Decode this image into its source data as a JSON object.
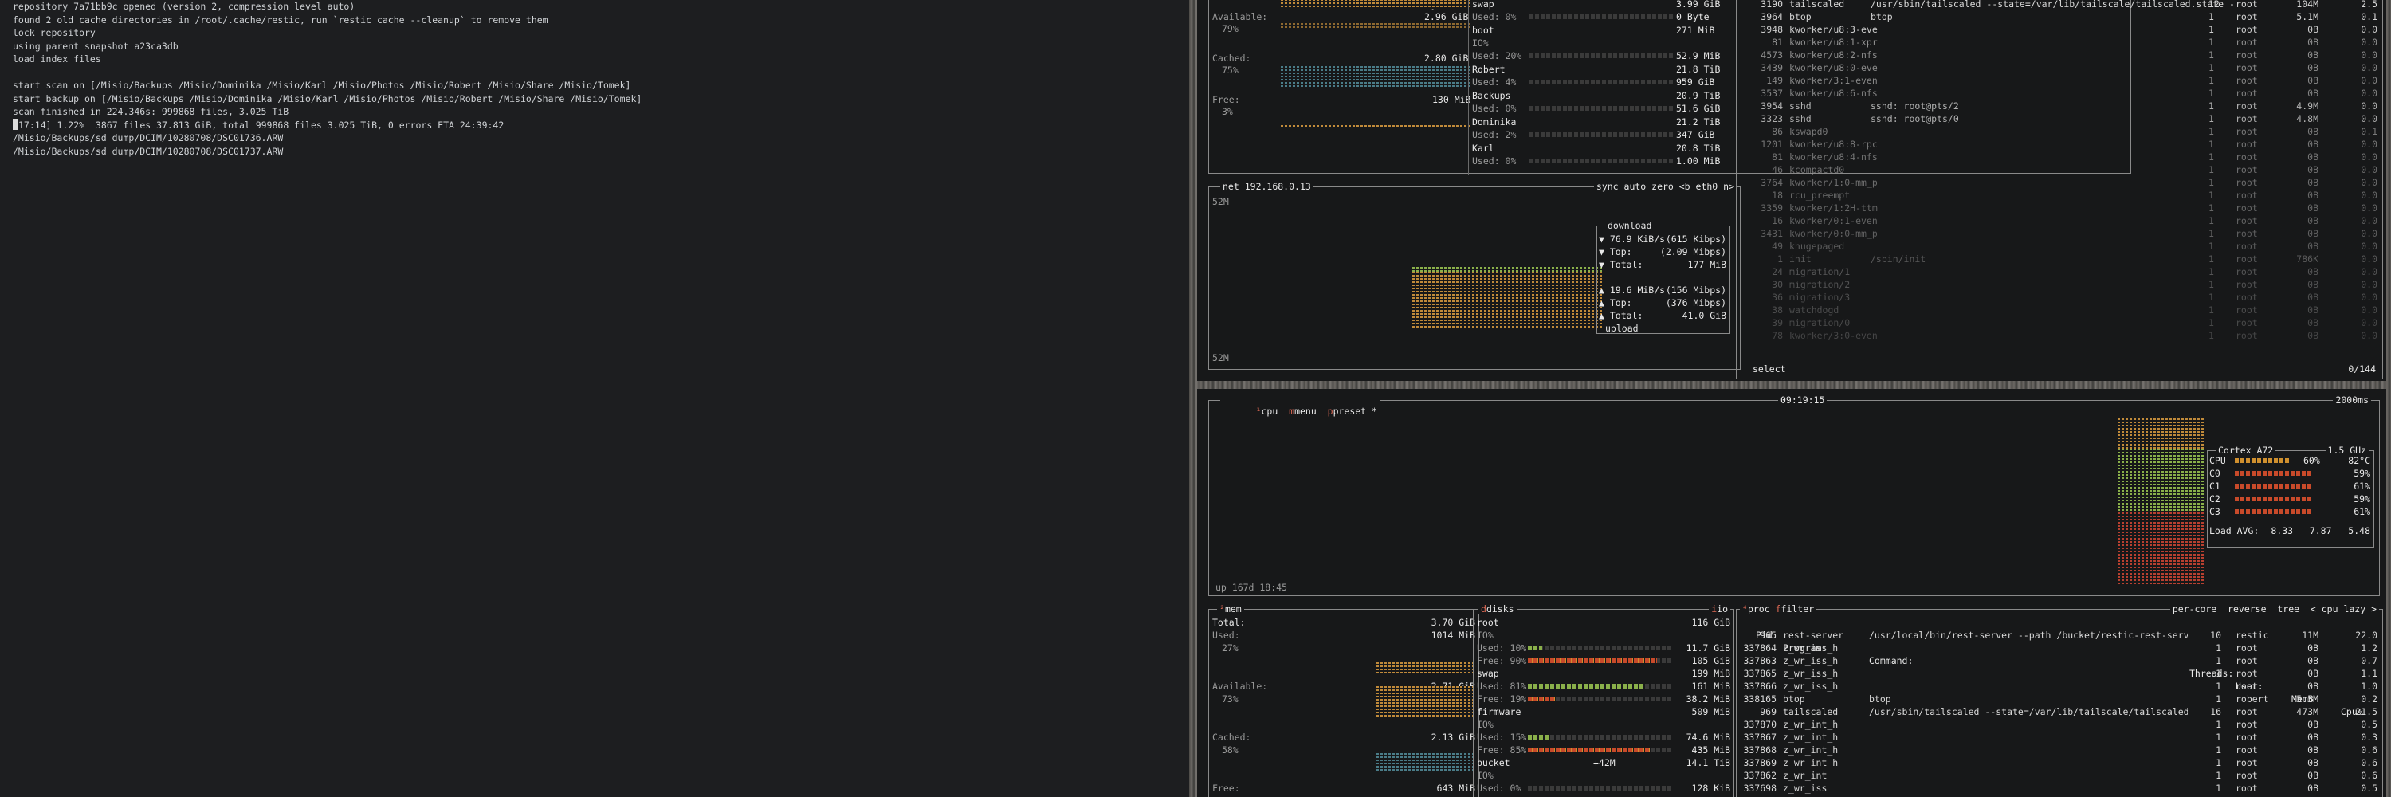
{
  "terminal": {
    "lines": [
      "repository 7a71bb9c opened (version 2, compression level auto)",
      "found 2 old cache directories in /root/.cache/restic, run `restic cache --cleanup` to remove them",
      "lock repository",
      "using parent snapshot a23ca3db",
      "load index files",
      "",
      "start scan on [/Misio/Backups /Misio/Dominika /Misio/Karl /Misio/Photos /Misio/Robert /Misio/Share /Misio/Tomek]",
      "start backup on [/Misio/Backups /Misio/Dominika /Misio/Karl /Misio/Photos /Misio/Robert /Misio/Share /Misio/Tomek]",
      "scan finished in 224.346s: 999868 files, 3.025 TiB"
    ],
    "progress_line": "[17:14] 1.22%  3867 files 37.813 GiB, total 999868 files 3.025 TiB, 0 errors ETA 24:39:42",
    "file_lines": [
      "/Misio/Backups/sd dump/DCIM/10280708/DSC01736.ARW",
      "/Misio/Backups/sd dump/DCIM/10280708/DSC01737.ARW"
    ]
  },
  "top_mem": {
    "available_label": "Available:",
    "available_pct": "79%",
    "available_val": "2.96 GiB",
    "cached_label": "Cached:",
    "cached_pct": "75%",
    "cached_val": "2.80 GiB",
    "free_label": "Free:",
    "free_pct": "3%",
    "free_val": "130 MiB",
    "extra_val": "0 Byte"
  },
  "top_disks": [
    {
      "name": "swap",
      "size": "3.99 GiB",
      "used": "Used: 0%",
      "used_val": "0 Byte"
    },
    {
      "name": "boot",
      "size": "271 MiB",
      "io": "IO%",
      "used": "Used: 20%",
      "used_val": "52.9 MiB"
    },
    {
      "name": "Robert",
      "size": "21.8 TiB",
      "used": "Used: 4%",
      "used_val": "959 GiB"
    },
    {
      "name": "Backups",
      "size": "20.9 TiB",
      "used": "Used: 0%",
      "used_val": "51.6 GiB"
    },
    {
      "name": "Dominika",
      "size": "21.2 TiB",
      "used": "Used: 2%",
      "used_val": "347 GiB"
    },
    {
      "name": "Karl",
      "size": "20.8 TiB",
      "used": "Used: 0%",
      "used_val": "1.00 MiB"
    }
  ],
  "net": {
    "title": "net",
    "ip": "192.168.0.13",
    "controls": "sync auto zero <b eth0 n>",
    "scale_top": "52M",
    "scale_bottom": "52M",
    "download_label": "download",
    "dl_rate": "▼ 76.9 KiB/s",
    "dl_rate_b": "(615 Kibps)",
    "dl_top": "▼ Top:",
    "dl_top_v": "(2.09 Mibps)",
    "dl_total": "▼ Total:",
    "dl_total_v": "177 MiB",
    "ul_rate": "▲ 19.6 MiB/s",
    "ul_rate_b": "(156 Mibps)",
    "ul_top": "▲ Top:",
    "ul_top_v": "(376 Mibps)",
    "ul_total": "▲ Total:",
    "ul_total_v": "41.0 GiB",
    "upload_label": "upload"
  },
  "top_procs": [
    {
      "pid": "3190",
      "name": "tailscaled",
      "cmd": "/usr/sbin/tailscaled --state=/var/lib/tailscale/tailscaled.state -",
      "thr": "12",
      "user": "root",
      "mem": "104M",
      "cpu": "2.5"
    },
    {
      "pid": "3964",
      "name": "btop",
      "cmd": "btop",
      "thr": "1",
      "user": "root",
      "mem": "5.1M",
      "cpu": "0.1"
    },
    {
      "pid": "3948",
      "name": "kworker/u8:3-eve",
      "cmd": "",
      "thr": "1",
      "user": "root",
      "mem": "0B",
      "cpu": "0.0"
    },
    {
      "pid": "81",
      "name": "kworker/u8:1-xpr",
      "cmd": "",
      "thr": "1",
      "user": "root",
      "mem": "0B",
      "cpu": "0.0"
    },
    {
      "pid": "4573",
      "name": "kworker/u8:2-nfs",
      "cmd": "",
      "thr": "1",
      "user": "root",
      "mem": "0B",
      "cpu": "0.0"
    },
    {
      "pid": "3439",
      "name": "kworker/u8:0-eve",
      "cmd": "",
      "thr": "1",
      "user": "root",
      "mem": "0B",
      "cpu": "0.0"
    },
    {
      "pid": "149",
      "name": "kworker/3:1-even",
      "cmd": "",
      "thr": "1",
      "user": "root",
      "mem": "0B",
      "cpu": "0.0"
    },
    {
      "pid": "3537",
      "name": "kworker/u8:6-nfs",
      "cmd": "",
      "thr": "1",
      "user": "root",
      "mem": "0B",
      "cpu": "0.0"
    },
    {
      "pid": "3954",
      "name": "sshd",
      "cmd": "sshd: root@pts/2",
      "thr": "1",
      "user": "root",
      "mem": "4.9M",
      "cpu": "0.0"
    },
    {
      "pid": "3323",
      "name": "sshd",
      "cmd": "sshd: root@pts/0",
      "thr": "1",
      "user": "root",
      "mem": "4.8M",
      "cpu": "0.0"
    },
    {
      "pid": "86",
      "name": "kswapd0",
      "cmd": "",
      "thr": "1",
      "user": "root",
      "mem": "0B",
      "cpu": "0.1"
    },
    {
      "pid": "1201",
      "name": "kworker/u8:8-rpc",
      "cmd": "",
      "thr": "1",
      "user": "root",
      "mem": "0B",
      "cpu": "0.0"
    },
    {
      "pid": "81",
      "name": "kworker/u8:4-nfs",
      "cmd": "",
      "thr": "1",
      "user": "root",
      "mem": "0B",
      "cpu": "0.0"
    },
    {
      "pid": "46",
      "name": "kcompactd0",
      "cmd": "",
      "thr": "1",
      "user": "root",
      "mem": "0B",
      "cpu": "0.0"
    },
    {
      "pid": "3764",
      "name": "kworker/1:0-mm_p",
      "cmd": "",
      "thr": "1",
      "user": "root",
      "mem": "0B",
      "cpu": "0.0"
    },
    {
      "pid": "18",
      "name": "rcu_preempt",
      "cmd": "",
      "thr": "1",
      "user": "root",
      "mem": "0B",
      "cpu": "0.0"
    },
    {
      "pid": "3359",
      "name": "kworker/1:2H-ttm",
      "cmd": "",
      "thr": "1",
      "user": "root",
      "mem": "0B",
      "cpu": "0.0"
    },
    {
      "pid": "16",
      "name": "kworker/0:1-even",
      "cmd": "",
      "thr": "1",
      "user": "root",
      "mem": "0B",
      "cpu": "0.0"
    },
    {
      "pid": "3431",
      "name": "kworker/0:0-mm_p",
      "cmd": "",
      "thr": "1",
      "user": "root",
      "mem": "0B",
      "cpu": "0.0"
    },
    {
      "pid": "49",
      "name": "khugepaged",
      "cmd": "",
      "thr": "1",
      "user": "root",
      "mem": "0B",
      "cpu": "0.0"
    },
    {
      "pid": "1",
      "name": "init",
      "cmd": "/sbin/init",
      "thr": "1",
      "user": "root",
      "mem": "786K",
      "cpu": "0.0"
    },
    {
      "pid": "24",
      "name": "migration/1",
      "cmd": "",
      "thr": "1",
      "user": "root",
      "mem": "0B",
      "cpu": "0.0"
    },
    {
      "pid": "30",
      "name": "migration/2",
      "cmd": "",
      "thr": "1",
      "user": "root",
      "mem": "0B",
      "cpu": "0.0"
    },
    {
      "pid": "36",
      "name": "migration/3",
      "cmd": "",
      "thr": "1",
      "user": "root",
      "mem": "0B",
      "cpu": "0.0"
    },
    {
      "pid": "38",
      "name": "watchdogd",
      "cmd": "",
      "thr": "1",
      "user": "root",
      "mem": "0B",
      "cpu": "0.0"
    },
    {
      "pid": "39",
      "name": "migration/0",
      "cmd": "",
      "thr": "1",
      "user": "root",
      "mem": "0B",
      "cpu": "0.0"
    },
    {
      "pid": "78",
      "name": "kworker/3:0-even",
      "cmd": "",
      "thr": "1",
      "user": "root",
      "mem": "0B",
      "cpu": "0.0"
    }
  ],
  "top_footer": {
    "select": "select",
    "count": "0/144"
  },
  "cpu": {
    "tabs": {
      "cpu": "cpu",
      "menu": "menu",
      "preset": "preset *"
    },
    "clock": "09:19:15",
    "interval": "2000ms",
    "uptime": "up 167d 18:45",
    "model": "Cortex A72",
    "freq": "1.5 GHz",
    "cores": [
      {
        "label": "CPU",
        "pct": "60%",
        "temp": "82°C"
      },
      {
        "label": "C0",
        "pct": "",
        "temp": "59%"
      },
      {
        "label": "C1",
        "pct": "",
        "temp": "61%"
      },
      {
        "label": "C2",
        "pct": "",
        "temp": "59%"
      },
      {
        "label": "C3",
        "pct": "",
        "temp": "61%"
      }
    ],
    "load_label": "Load AVG:",
    "load_values": "8.33   7.87   5.48"
  },
  "mem": {
    "title": "mem",
    "total_label": "Total:",
    "total_val": "3.70 GiB",
    "used_label": "Used:",
    "used_pct": "27%",
    "used_val": "1014 MiB",
    "avail_label": "Available:",
    "avail_pct": "73%",
    "avail_val": "2.71 GiB",
    "cached_label": "Cached:",
    "cached_pct": "58%",
    "cached_val": "2.13 GiB",
    "free_label": "Free:",
    "free_val": "643 MiB"
  },
  "disks": {
    "title": "disks",
    "io": "io",
    "items": [
      {
        "name": "root",
        "size": "116 GiB",
        "io": "IO%",
        "used": "Used: 10%",
        "used_val": "11.7 GiB",
        "free": "Free: 90%",
        "free_val": "105 GiB",
        "used_frac": 0.1,
        "free_frac": 0.9
      },
      {
        "name": "swap",
        "size": "199 MiB",
        "used": "Used: 81%",
        "used_val": "161 MiB",
        "free": "Free: 19%",
        "free_val": "38.2 MiB",
        "used_frac": 0.81,
        "free_frac": 0.19
      },
      {
        "name": "firmware",
        "size": "509 MiB",
        "io": "IO%",
        "used": "Used: 15%",
        "used_val": "74.6 MiB",
        "free": "Free: 85%",
        "free_val": "435 MiB",
        "used_frac": 0.15,
        "free_frac": 0.85
      },
      {
        "name": "bucket",
        "size": "14.1 TiB",
        "io": "IO%",
        "rate": "+42M",
        "used": "Used: 0%",
        "used_val": "128 KiB"
      }
    ]
  },
  "proc": {
    "title": "proc",
    "filter": "filter",
    "controls": "per-core  reverse  tree  < cpu lazy >",
    "headers": {
      "pid": "Pid:",
      "program": "Program:",
      "command": "Command:",
      "threads": "Threads:",
      "user": "User:",
      "mem": "MemB",
      "cpu": "Cpu%"
    },
    "rows": [
      {
        "pid": "965",
        "name": "rest-server",
        "cmd": "/usr/local/bin/rest-server --path /bucket/restic-rest-server --pri",
        "thr": "10",
        "user": "restic",
        "mem": "11M",
        "cpu": "22.0"
      },
      {
        "pid": "337864",
        "name": "z_wr_iss_h",
        "cmd": "",
        "thr": "1",
        "user": "root",
        "mem": "0B",
        "cpu": "1.2"
      },
      {
        "pid": "337863",
        "name": "z_wr_iss_h",
        "cmd": "",
        "thr": "1",
        "user": "root",
        "mem": "0B",
        "cpu": "0.7"
      },
      {
        "pid": "337865",
        "name": "z_wr_iss_h",
        "cmd": "",
        "thr": "1",
        "user": "root",
        "mem": "0B",
        "cpu": "1.1"
      },
      {
        "pid": "337866",
        "name": "z_wr_iss_h",
        "cmd": "",
        "thr": "1",
        "user": "root",
        "mem": "0B",
        "cpu": "1.0"
      },
      {
        "pid": "338165",
        "name": "btop",
        "cmd": "btop",
        "thr": "1",
        "user": "robert",
        "mem": "5.5M",
        "cpu": "0.2"
      },
      {
        "pid": "969",
        "name": "tailscaled",
        "cmd": "/usr/sbin/tailscaled --state=/var/lib/tailscale/tailscaled.state -",
        "thr": "16",
        "user": "root",
        "mem": "473M",
        "cpu": "21.5"
      },
      {
        "pid": "337870",
        "name": "z_wr_int_h",
        "cmd": "",
        "thr": "1",
        "user": "root",
        "mem": "0B",
        "cpu": "0.5"
      },
      {
        "pid": "337867",
        "name": "z_wr_int_h",
        "cmd": "",
        "thr": "1",
        "user": "root",
        "mem": "0B",
        "cpu": "0.3"
      },
      {
        "pid": "337868",
        "name": "z_wr_int_h",
        "cmd": "",
        "thr": "1",
        "user": "root",
        "mem": "0B",
        "cpu": "0.6"
      },
      {
        "pid": "337869",
        "name": "z_wr_int_h",
        "cmd": "",
        "thr": "1",
        "user": "root",
        "mem": "0B",
        "cpu": "0.6"
      },
      {
        "pid": "337862",
        "name": "z_wr_int",
        "cmd": "",
        "thr": "1",
        "user": "root",
        "mem": "0B",
        "cpu": "0.6"
      },
      {
        "pid": "337698",
        "name": "z_wr_iss",
        "cmd": "",
        "thr": "1",
        "user": "root",
        "mem": "0B",
        "cpu": "0.5"
      }
    ]
  },
  "colors": {
    "accent_red": "#e06a55",
    "meter_green": "#8ab04a",
    "meter_orange": "#d0902e",
    "meter_red": "#c84a2a",
    "graph_teal": "#4a7c88"
  }
}
